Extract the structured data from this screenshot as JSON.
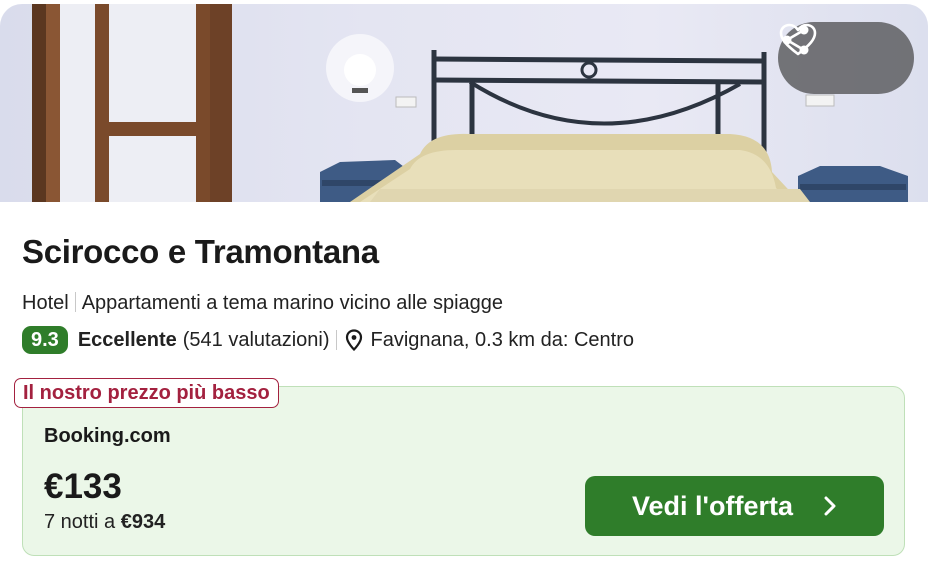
{
  "hotel": {
    "name": "Scirocco e Tramontana",
    "type": "Hotel",
    "description": "Appartamenti a tema marino vicino alle spiagge",
    "rating": {
      "score": "9.3",
      "verdict": "Eccellente",
      "count": "(541 valutazioni)"
    },
    "location": "Favignana, 0.3 km da: Centro"
  },
  "actions": {
    "share_icon": "share-icon",
    "favorite_icon": "heart-icon"
  },
  "offer": {
    "badge": "Il nostro prezzo più basso",
    "provider": "Booking.com",
    "price": "€133",
    "total_prefix": "7 notti a",
    "total_amount": "€934",
    "cta": "Vedi l'offerta"
  },
  "colors": {
    "accent_green": "#2f7d2a",
    "badge_red": "#a3213f",
    "offer_bg": "#ebf7e8"
  }
}
